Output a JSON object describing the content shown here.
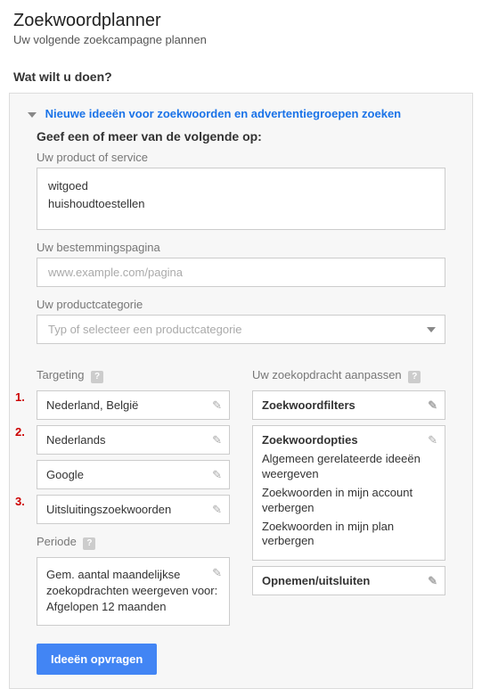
{
  "header": {
    "title": "Zoekwoordplanner",
    "subtitle": "Uw volgende zoekcampagne plannen"
  },
  "question": "Wat wilt u doen?",
  "panel": {
    "link": "Nieuwe ideeën voor zoekwoorden en advertentiegroepen zoeken",
    "section_title": "Geef een of meer van de volgende op:",
    "product_label": "Uw product of service",
    "product_value": "witgoed\nhuishoudtoestellen",
    "landing_label": "Uw bestemmingspagina",
    "landing_placeholder": "www.example.com/pagina",
    "category_label": "Uw productcategorie",
    "category_placeholder": "Typ of selecteer een productcategorie"
  },
  "targeting": {
    "title": "Targeting",
    "nums": {
      "one": "1.",
      "two": "2.",
      "three": "3."
    },
    "location": "Nederland, België",
    "language": "Nederlands",
    "network": "Google",
    "negative": "Uitsluitingszoekwoorden"
  },
  "periode": {
    "title": "Periode",
    "text": "Gem. aantal maandelijkse zoekopdrachten weergeven voor: Afgelopen 12 maanden"
  },
  "customize": {
    "title": "Uw zoekopdracht aanpassen",
    "filters": "Zoekwoordfilters",
    "options_title": "Zoekwoordopties",
    "opt1": "Algemeen gerelateerde ideeën weergeven",
    "opt2": "Zoekwoorden in mijn account verbergen",
    "opt3": "Zoekwoorden in mijn plan verbergen",
    "include": "Opnemen/uitsluiten"
  },
  "button": "Ideeën opvragen",
  "help": "?"
}
